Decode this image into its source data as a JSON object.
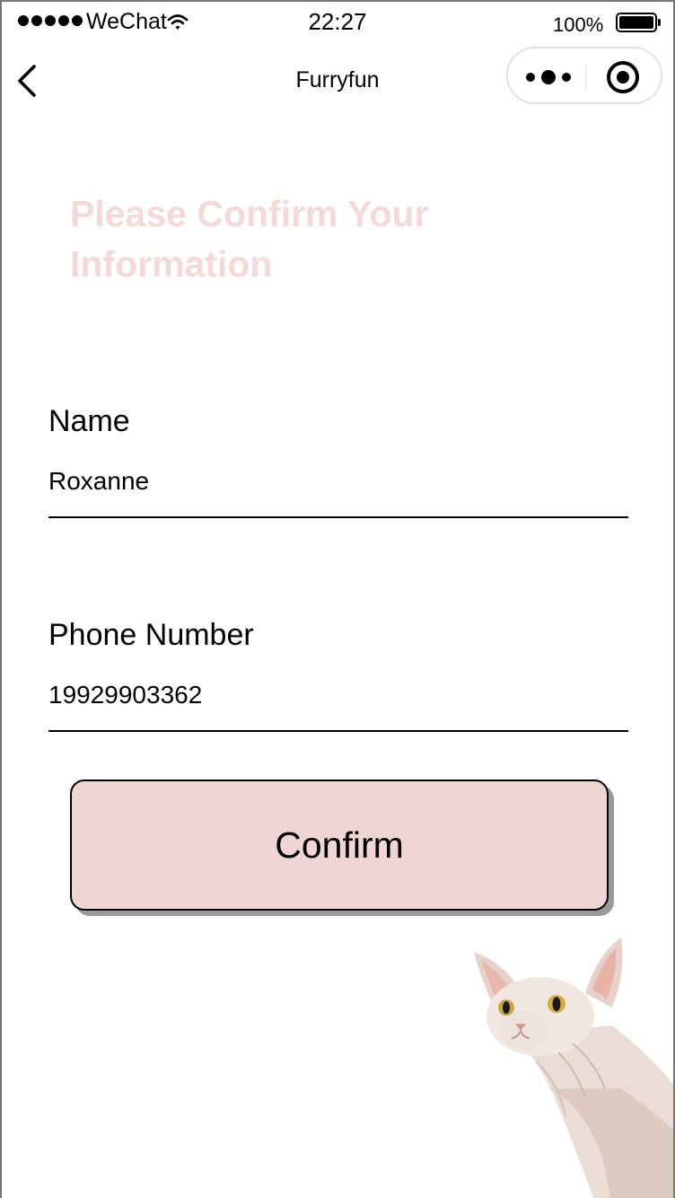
{
  "status_bar": {
    "carrier": "WeChat",
    "time": "22:27",
    "battery": "100%"
  },
  "nav": {
    "title": "Furryfun"
  },
  "heading": "Please Confirm Your Information",
  "form": {
    "name_label": "Name",
    "name_value": "Roxanne",
    "phone_label": "Phone Number",
    "phone_value": "19929903362"
  },
  "confirm_label": "Confirm",
  "colors": {
    "accent": "#efd5d3",
    "heading": "#f3dad6"
  },
  "icons": [
    "signal-icon",
    "wifi-icon",
    "battery-icon",
    "back-icon",
    "more-icon",
    "close-icon"
  ]
}
